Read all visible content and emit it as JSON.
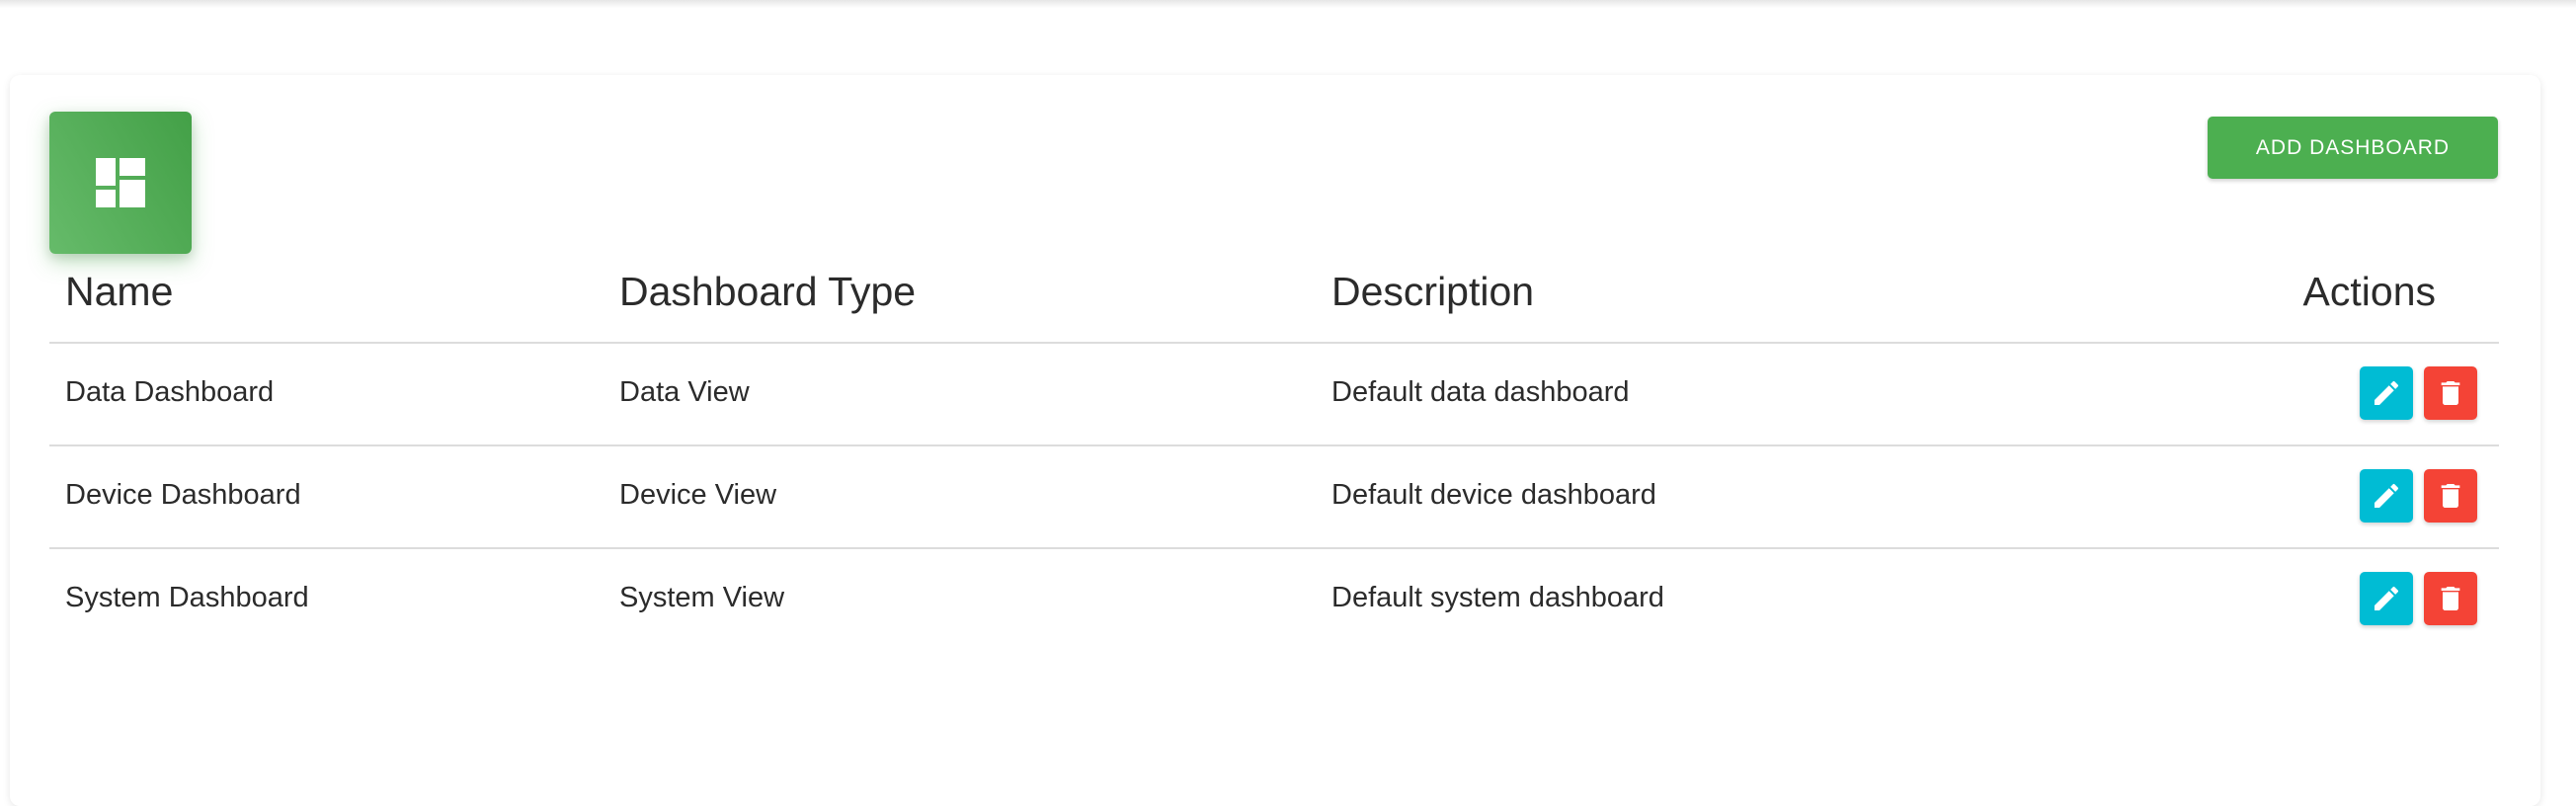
{
  "header": {
    "add_button_label": "ADD DASHBOARD",
    "icon": "dashboard-icon",
    "accent_color": "#4caf50"
  },
  "table": {
    "columns": [
      "Name",
      "Dashboard Type",
      "Description",
      "Actions"
    ],
    "rows": [
      {
        "name": "Data Dashboard",
        "type": "Data View",
        "description": "Default data dashboard"
      },
      {
        "name": "Device Dashboard",
        "type": "Device View",
        "description": "Default device dashboard"
      },
      {
        "name": "System Dashboard",
        "type": "System View",
        "description": "Default system dashboard"
      }
    ],
    "actions": {
      "edit_icon": "pencil-icon",
      "delete_icon": "trash-icon",
      "edit_color": "#00bcd4",
      "delete_color": "#f44336"
    }
  }
}
